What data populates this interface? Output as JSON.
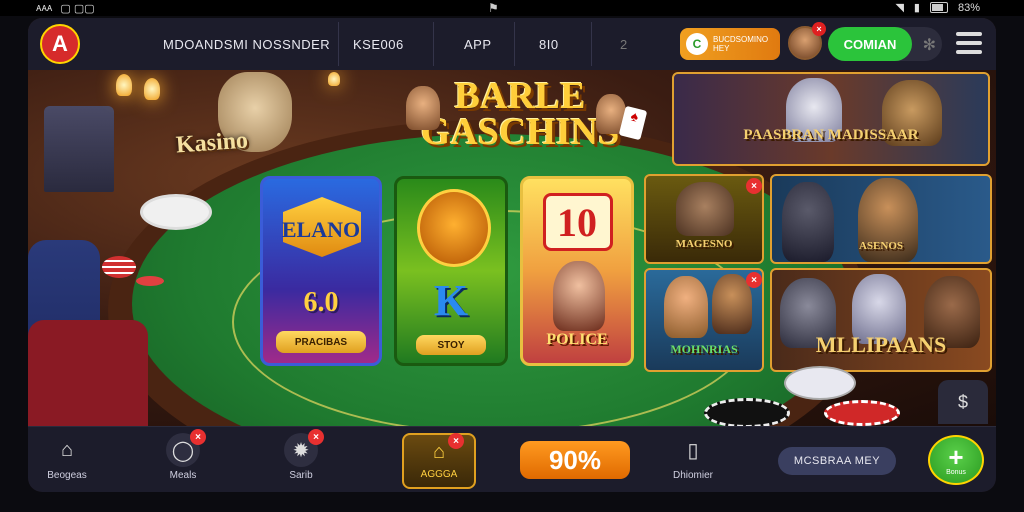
{
  "status_bar": {
    "left": [
      "ᴀᴀᴀ",
      "▢ ▢▢"
    ],
    "center_icon": "notification-icon",
    "right_text": "83%"
  },
  "header": {
    "logo_letter": "A",
    "nav": [
      "MDOANDSMI NOSSNDER",
      "KSE006",
      "APP",
      "8I0",
      "2"
    ],
    "promo": {
      "badge": "C",
      "text_line1": "BUCDSOMINO",
      "text_line2": "HEY"
    },
    "avatar_badge": "×",
    "join_label": "COMIAN"
  },
  "scene": {
    "sign_text": "Kasino",
    "game_title_line1": "BARLE",
    "game_title_line2": "GASCHINS"
  },
  "cards": [
    {
      "title": "ELANO",
      "big": "6.0",
      "button": "PRACIBAS"
    },
    {
      "title": "K",
      "button": "STOY"
    },
    {
      "title": "10",
      "label": "POLICE"
    }
  ],
  "tiles": {
    "hero_top": "PAASBRAN MADISSAAR",
    "wolf_small": "MAGESNO",
    "cowboys": "ASENOS",
    "outlaws": "MOHNRIAS",
    "wolves": "MLLIPAANS"
  },
  "bottom_bar": {
    "tabs": [
      {
        "label": "Beogeas",
        "icon": "house-icon"
      },
      {
        "label": "Meals",
        "icon": "ring-icon",
        "badge": "×"
      },
      {
        "label": "Sarib",
        "icon": "gear-icon",
        "badge": "×"
      },
      {
        "label": "AGGGA",
        "icon": "home-gold-icon",
        "badge": "×"
      },
      {
        "label": "Dhiomier",
        "icon": "phone-icon"
      }
    ],
    "percent_button": "90%",
    "pill_label": "MCSBRAA MEY",
    "plus_label": "Bonus"
  }
}
